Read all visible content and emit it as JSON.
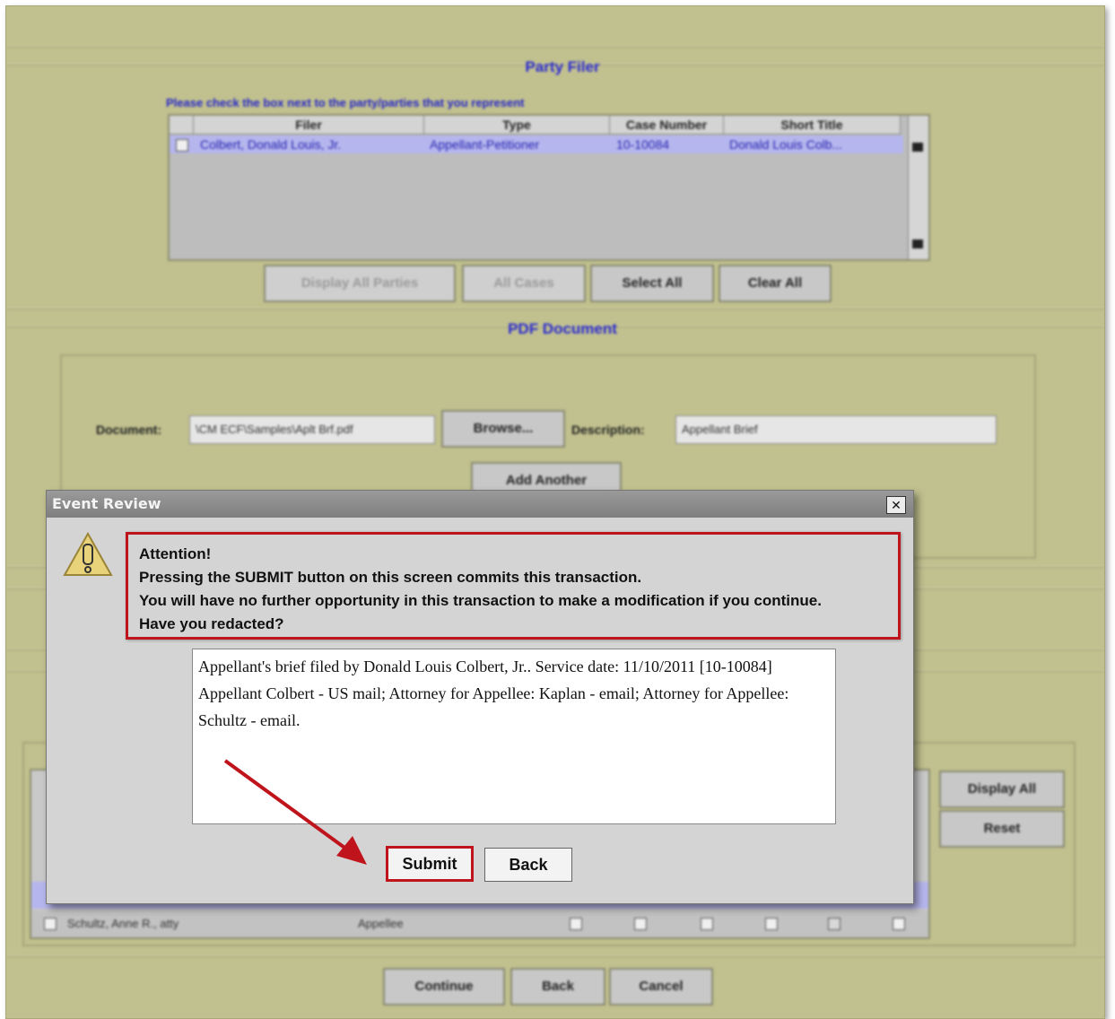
{
  "party_filer": {
    "title": "Party Filer",
    "instruction": "Please check the box next to the party/parties that you represent",
    "columns": [
      "Filer",
      "Type",
      "Case Number",
      "Short Title"
    ],
    "rows": [
      {
        "filer": "Colbert, Donald Louis, Jr.",
        "type": "Appellant-Petitioner",
        "case_number": "10-10084",
        "short_title": "Donald Louis Colb..."
      }
    ],
    "buttons": {
      "display_all_parties": "Display All Parties",
      "all_cases": "All Cases",
      "select_all": "Select All",
      "clear_all": "Clear All"
    }
  },
  "pdf_document": {
    "title": "PDF Document",
    "document_label": "Document:",
    "document_value": "\\CM ECF\\Samples\\Aplt Brf.pdf",
    "browse_label": "Browse...",
    "description_label": "Description:",
    "description_value": "Appellant Brief",
    "add_another_label": "Add Another"
  },
  "service": {
    "display_all_label": "Display All",
    "reset_label": "Reset",
    "last_row": {
      "name": "Schultz, Anne R., atty",
      "type": "Appellee"
    }
  },
  "footer": {
    "continue_label": "Continue",
    "back_label": "Back",
    "cancel_label": "Cancel"
  },
  "dialog": {
    "title": "Event Review",
    "close_glyph": "✕",
    "icon": "warning-icon",
    "message": [
      "Attention!",
      "Pressing the SUBMIT button on this screen commits this transaction.",
      "You will have no further opportunity in this transaction to make a modification if you continue.",
      "Have you redacted?"
    ],
    "docket_text": "Appellant's brief filed by Donald Louis Colbert, Jr.. Service date: 11/10/2011 [10-10084] Appellant Colbert - US mail; Attorney for Appellee: Kaplan - email; Attorney for Appellee: Schultz - email.",
    "submit_label": "Submit",
    "back_label": "Back"
  },
  "colors": {
    "background": "#c1c18f",
    "highlight": "#c0141c",
    "section_title": "#2a2ad0"
  }
}
